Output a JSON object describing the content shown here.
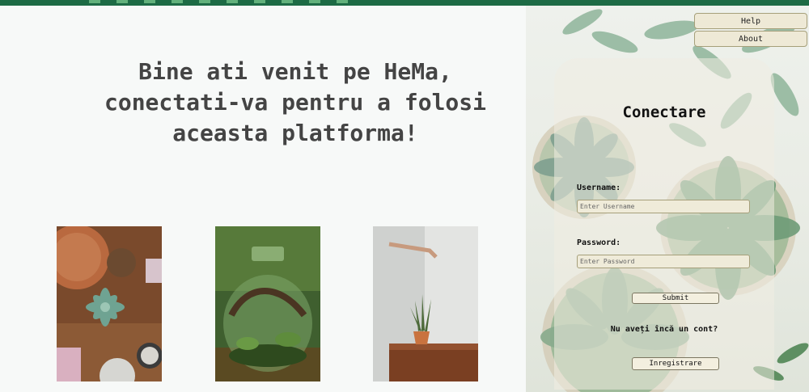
{
  "nav": {
    "help_label": "Help",
    "about_label": "About"
  },
  "welcome": {
    "line1": "Bine ati venit pe HeMa,",
    "line2": "conectati-va pentru a folosi",
    "line3": "aceasta platforma!"
  },
  "login": {
    "title": "Conectare",
    "username_label": "Username:",
    "username_placeholder": "Enter Username",
    "username_value": "",
    "password_label": "Password:",
    "password_placeholder": "Enter Password",
    "password_value": "",
    "submit_label": "Submit",
    "no_account_text": "Nu aveți încă un cont?",
    "register_label": "Inregistrare"
  },
  "colors": {
    "accent_bar": "#1d6b45",
    "heading_text": "#444444",
    "input_bg": "#efebd9",
    "button_bg": "#eee9d6"
  },
  "images": [
    {
      "name": "succulents-table-photo",
      "alt": "succulents in pots on wooden table"
    },
    {
      "name": "terrarium-jar-photo",
      "alt": "glass jar terrarium"
    },
    {
      "name": "snake-plant-photo",
      "alt": "snake plant on wooden cabinet"
    }
  ]
}
